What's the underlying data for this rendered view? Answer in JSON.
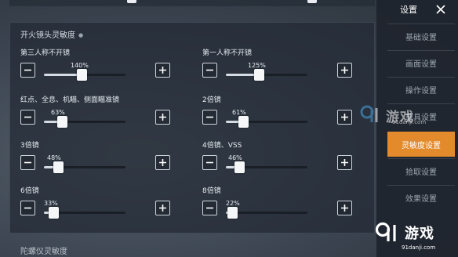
{
  "section_title": "开火镜头灵敏度",
  "settings": [
    {
      "label": "第三人称不开镜",
      "value_text": "140%",
      "fraction": 0.46
    },
    {
      "label": "第一人称不开镜",
      "value_text": "125%",
      "fraction": 0.4
    },
    {
      "label": "红点、全息、机瞄、侧面瞄准镜",
      "value_text": "63%",
      "fraction": 0.22
    },
    {
      "label": "2倍镜",
      "value_text": "61%",
      "fraction": 0.21
    },
    {
      "label": "3倍镜",
      "value_text": "48%",
      "fraction": 0.17
    },
    {
      "label": "4倍镜、VSS",
      "value_text": "46%",
      "fraction": 0.16
    },
    {
      "label": "6倍镜",
      "value_text": "33%",
      "fraction": 0.12
    },
    {
      "label": "8倍镜",
      "value_text": "22%",
      "fraction": 0.08
    }
  ],
  "bottom_section_title": "陀螺仪灵敏度",
  "sidebar": {
    "title": "设置",
    "items": [
      {
        "label": "基础设置",
        "active": false
      },
      {
        "label": "画面设置",
        "active": false
      },
      {
        "label": "操作设置",
        "active": false
      },
      {
        "label": "载具设置",
        "active": false
      },
      {
        "label": "灵敏度设置",
        "active": true
      },
      {
        "label": "拾取设置",
        "active": false
      },
      {
        "label": "效果设置",
        "active": false
      }
    ]
  },
  "watermark": {
    "logo_text": "游戏",
    "url": "91danji.com"
  },
  "colors": {
    "accent": "#e38a2c",
    "panel": "#222934",
    "slider_fill": "#d5dbe2"
  }
}
